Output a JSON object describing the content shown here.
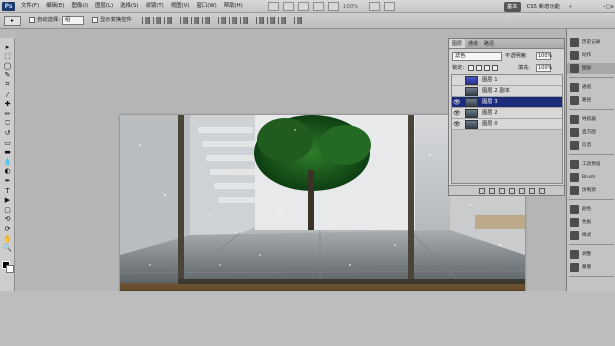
{
  "app": {
    "logo": "Ps"
  },
  "menu": [
    "文件(F)",
    "编辑(E)",
    "图像(I)",
    "图层(L)",
    "选择(S)",
    "滤镜(T)",
    "视图(V)",
    "窗口(W)",
    "帮助(H)"
  ],
  "menu_tools": {
    "zoom": "100%"
  },
  "workspace": {
    "active": "基本",
    "items": [
      "CS5 新增功能",
      "»",
      "CS Live"
    ]
  },
  "window_controls": "–□x",
  "options_bar": {
    "tool_preset_icon": "move-tool-icon",
    "auto_select_label": "自动选择:",
    "auto_select_value": "组",
    "show_transform_label": "显示变换控件"
  },
  "tools": [
    "move",
    "marquee",
    "lasso",
    "quick-select",
    "crop",
    "eyedropper",
    "healing",
    "brush",
    "clone-stamp",
    "history-brush",
    "eraser",
    "gradient",
    "blur",
    "dodge",
    "pen",
    "type",
    "path-select",
    "shape",
    "3d-rotate",
    "3d-orbit",
    "hand",
    "zoom"
  ],
  "tool_glyphs": [
    "▸",
    "⬚",
    "◯",
    "✎",
    "⌗",
    "⁄",
    "✚",
    "✏",
    "⎕",
    "↺",
    "▭",
    "▬",
    "💧",
    "◐",
    "✒",
    "T",
    "▶",
    "▢",
    "⟲",
    "⟳",
    "✋",
    "🔍"
  ],
  "layers_panel": {
    "tabs": [
      "图层",
      "通道",
      "路径"
    ],
    "blend_mode": "滤色",
    "opacity_label": "不透明度:",
    "opacity": "100%",
    "lock_label": "锁定:",
    "fill_label": "填充:",
    "fill": "100%",
    "layers": [
      {
        "name": "图层 1",
        "visible": false,
        "selected": false,
        "thumb": "blue"
      },
      {
        "name": "图层 2 副本",
        "visible": false,
        "selected": false,
        "thumb": "photo"
      },
      {
        "name": "图层 3",
        "visible": true,
        "selected": true,
        "thumb": "photo"
      },
      {
        "name": "图层 2",
        "visible": true,
        "selected": false,
        "thumb": "photo"
      },
      {
        "name": "图层 0",
        "visible": true,
        "selected": false,
        "thumb": "photo"
      }
    ]
  },
  "right_dock": {
    "groups": [
      [
        "历史记录",
        "动作",
        "图层"
      ],
      [
        "通道",
        "路径"
      ],
      [
        "导航器",
        "直方图",
        "信息"
      ],
      [
        "工具预设",
        "Brush",
        "仿制源"
      ],
      [
        "颜色",
        "色板",
        "样式"
      ],
      [
        "调整",
        "蒙版"
      ]
    ],
    "active": "图层"
  },
  "colors": {
    "accent": "#1c2c7a",
    "foreground": "#000000",
    "background": "#ffffff"
  }
}
